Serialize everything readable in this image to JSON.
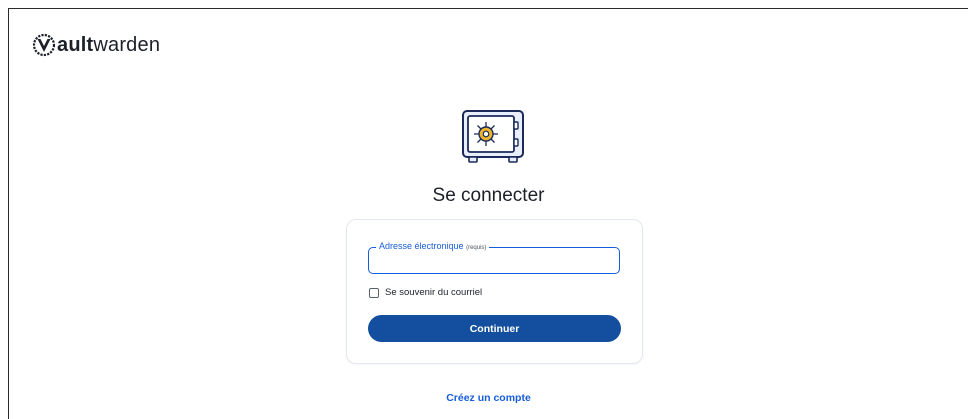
{
  "header": {
    "logo_bold": "ault",
    "logo_regular": "warden",
    "logo_icon": "vaultwarden-v-icon"
  },
  "login": {
    "hero_icon": "safe-vault-icon",
    "title": "Se connecter",
    "email_label": "Adresse électronique",
    "email_required": "(requis)",
    "email_value": "",
    "remember_label": "Se souvenir du courriel",
    "remember_checked": false,
    "continue_label": "Continuer",
    "create_account_label": "Créez un compte"
  },
  "colors": {
    "primary": "#175ddc",
    "button": "#134f9e",
    "text": "#1b2029",
    "vault_gear": "#f0b429"
  }
}
